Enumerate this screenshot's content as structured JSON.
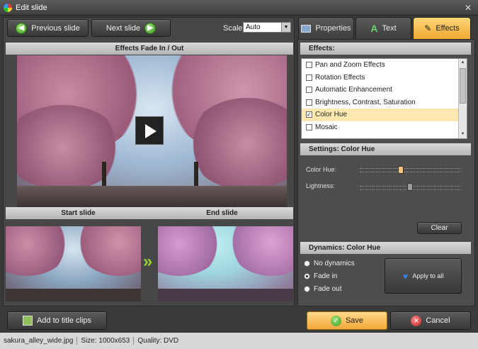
{
  "window": {
    "title": "Edit slide"
  },
  "toolbar": {
    "prev_label": "Previous slide",
    "next_label": "Next slide",
    "scale_label": "Scale:",
    "scale_value": "Auto"
  },
  "tabs": [
    {
      "label": "Properties",
      "icon": "properties-icon"
    },
    {
      "label": "Text",
      "icon": "text-icon"
    },
    {
      "label": "Effects",
      "icon": "effects-icon",
      "active": true
    }
  ],
  "preview": {
    "title": "Effects Fade In / Out",
    "start_label": "Start slide",
    "end_label": "End slide"
  },
  "effects": {
    "header": "Effects:",
    "items": [
      {
        "label": "Pan and Zoom Effects",
        "checked": false
      },
      {
        "label": "Rotation Effects",
        "checked": false
      },
      {
        "label": "Automatic Enhancement",
        "checked": false
      },
      {
        "label": "Brightness, Contrast, Saturation",
        "checked": false
      },
      {
        "label": "Color Hue",
        "checked": true,
        "selected": true
      },
      {
        "label": "Mosaic",
        "checked": false
      }
    ]
  },
  "settings": {
    "header": "Settings: Color Hue",
    "color_hue_label": "Color Hue:",
    "lightness_label": "Lightness:",
    "clear_label": "Clear",
    "color_hue_fraction": 0.4,
    "lightness_fraction": 0.5
  },
  "dynamics": {
    "header": "Dynamics: Color Hue",
    "options": [
      {
        "label": "No dynamics",
        "checked": false
      },
      {
        "label": "Fade in",
        "checked": true
      },
      {
        "label": "Fade out",
        "checked": false
      }
    ],
    "apply_label": "Apply to all"
  },
  "bottom": {
    "add_title_label": "Add to title clips",
    "save_label": "Save",
    "cancel_label": "Cancel"
  },
  "status": {
    "file": "sakura_alley_wide.jpg",
    "size": "Size: 1000x653",
    "quality": "Quality: DVD"
  },
  "colors": {
    "accent": "#f5b742",
    "selected_row": "#fde9b0",
    "save": "#f7c25a"
  }
}
